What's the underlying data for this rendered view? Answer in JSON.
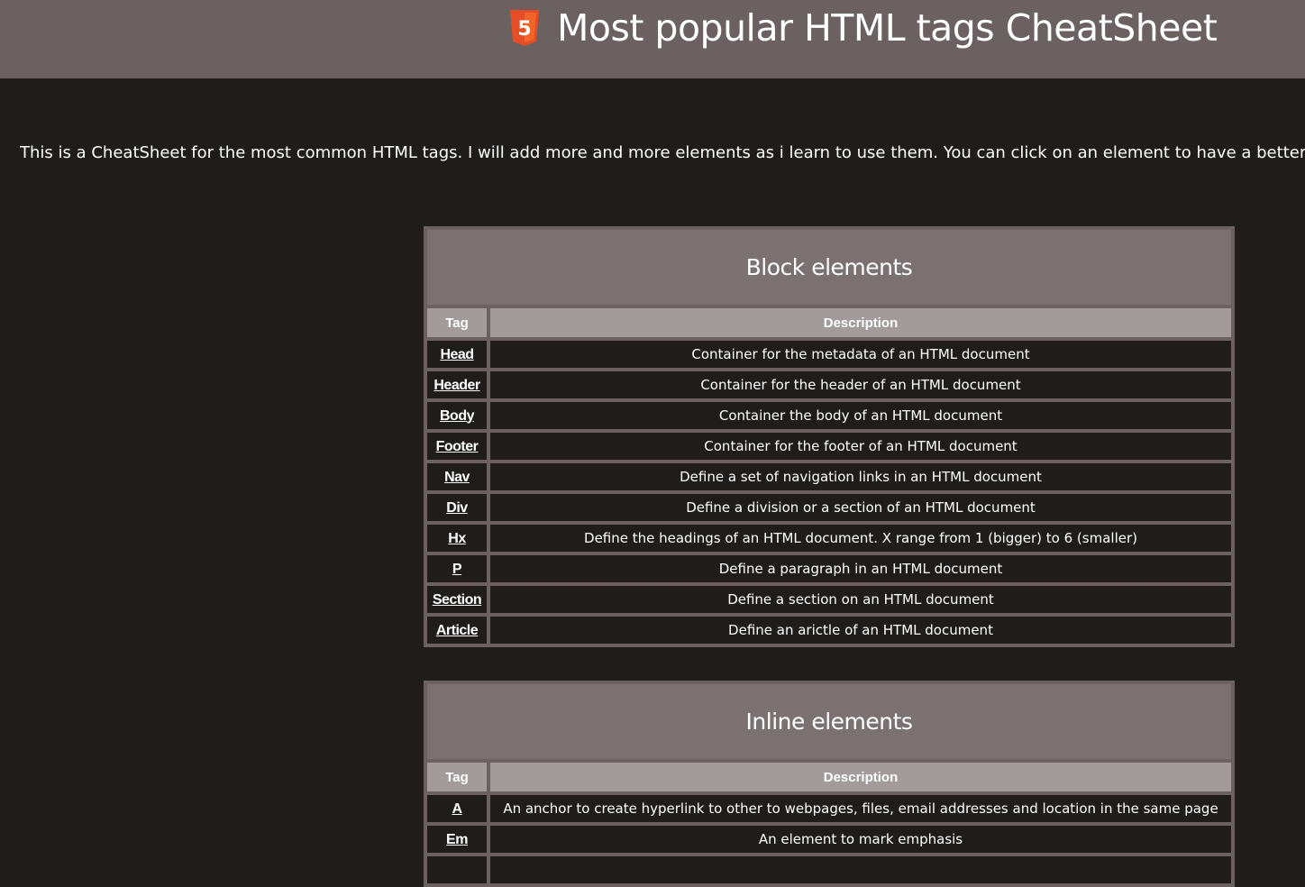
{
  "header": {
    "title": "Most popular HTML tags CheatSheet",
    "logo_icon": "html5-logo-icon",
    "logo_text": "5"
  },
  "intro": "This is a CheatSheet for the most common HTML tags. I will add more and more elements as i learn to use them. You can click on an element to have a better d",
  "colors": {
    "header_bg": "#6a6160",
    "page_bg": "#201c1c",
    "caption_bg": "#7b7170",
    "column_header_bg": "#a29b9a",
    "html5_orange": "#e44d26"
  },
  "block_table": {
    "caption": "Block elements",
    "headers": [
      "Tag",
      "Description"
    ],
    "rows": [
      {
        "tag": "Head",
        "description": "Container for the metadata of an HTML document"
      },
      {
        "tag": "Header",
        "description": "Container for the header of an HTML document"
      },
      {
        "tag": "Body",
        "description": "Container the body of an HTML document"
      },
      {
        "tag": "Footer",
        "description": "Container for the footer of an HTML document"
      },
      {
        "tag": "Nav",
        "description": "Define a set of navigation links in an HTML document"
      },
      {
        "tag": "Div",
        "description": "Define a division or a section of an HTML document"
      },
      {
        "tag": "Hx",
        "description": "Define the headings of an HTML document. X range from 1 (bigger) to 6 (smaller)"
      },
      {
        "tag": "P",
        "description": "Define a paragraph in an HTML document"
      },
      {
        "tag": "Section",
        "description": "Define a section on an HTML document"
      },
      {
        "tag": "Article",
        "description": "Define an arictle of an HTML document"
      }
    ]
  },
  "inline_table": {
    "caption": "Inline elements",
    "headers": [
      "Tag",
      "Description"
    ],
    "rows": [
      {
        "tag": "A",
        "description": "An anchor to create hyperlink to other to webpages, files, email addresses and location in the same page"
      },
      {
        "tag": "Em",
        "description": "An element to mark emphasis"
      },
      {
        "tag": "",
        "description": ""
      }
    ]
  }
}
